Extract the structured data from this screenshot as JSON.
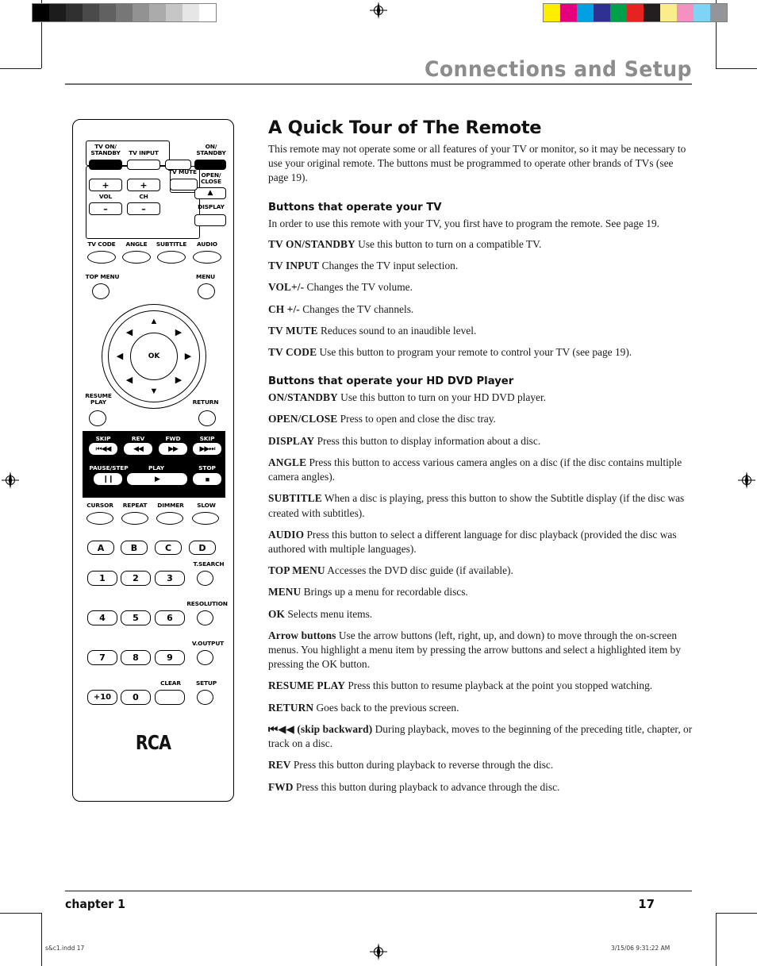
{
  "printer_marks": {
    "grayscale_steps": [
      "#000000",
      "#1c1c1c",
      "#303030",
      "#4a4a4a",
      "#606060",
      "#777777",
      "#929292",
      "#ababab",
      "#c6c6c6",
      "#e6e6e6",
      "#ffffff"
    ],
    "color_steps": [
      "#ffed00",
      "#e5007d",
      "#00a0e3",
      "#2e3192",
      "#00a04a",
      "#e52421",
      "#231f20",
      "#fbee8a",
      "#f391c0",
      "#7fd4f5",
      "#939598"
    ],
    "registration_icon": "registration-target-icon"
  },
  "header": {
    "title": "Connections and Setup"
  },
  "remote": {
    "brand": "RCA",
    "labels": {
      "tv_on_standby": "TV ON/\nSTANDBY",
      "tv_input": "TV INPUT",
      "on_standby": "ON/\nSTANDBY",
      "open_close": "OPEN/\nCLOSE",
      "display": "DISPLAY",
      "tv_mute": "TV MUTE",
      "vol": "VOL",
      "ch": "CH",
      "plus": "+",
      "minus": "–",
      "eject": "▲",
      "tv_code": "TV CODE",
      "angle": "ANGLE",
      "subtitle": "SUBTITLE",
      "audio": "AUDIO",
      "top_menu": "TOP MENU",
      "menu": "MENU",
      "ok": "OK",
      "resume_play": "RESUME\nPLAY",
      "return": "RETURN",
      "cursor": "CURSOR",
      "repeat": "REPEAT",
      "dimmer": "DIMMER",
      "slow": "SLOW",
      "t_search": "T.SEARCH",
      "resolution": "RESOLUTION",
      "v_output": "V.OUTPUT",
      "clear": "CLEAR",
      "setup": "SETUP"
    },
    "transport": {
      "skip_back_label": "SKIP",
      "rev_label": "REV",
      "fwd_label": "FWD",
      "skip_fwd_label": "SKIP",
      "pause_label": "PAUSE/STEP",
      "play_label": "PLAY",
      "stop_label": "STOP",
      "skip_back_glyph": "⏮◀◀",
      "rev_glyph": "◀◀",
      "fwd_glyph": "▶▶",
      "skip_fwd_glyph": "▶▶⏭",
      "pause_glyph": "❙❙",
      "play_glyph": "▶",
      "stop_glyph": "■"
    },
    "color_keys": [
      "A",
      "B",
      "C",
      "D"
    ],
    "numeric_keys": [
      "1",
      "2",
      "3",
      "4",
      "5",
      "6",
      "7",
      "8",
      "9",
      "+10",
      "0"
    ]
  },
  "content": {
    "title": "A Quick Tour of The Remote",
    "intro": "This remote may not operate some or all features of your TV or monitor, so it may be necessary to use your original remote. The buttons must be programmed to operate other brands of TVs (see page 19).",
    "tv_section": {
      "heading": "Buttons that operate your TV",
      "intro": "In order to use this remote with your TV, you first have to program the remote. See page 19.",
      "entries": [
        {
          "term": "TV ON/STANDBY",
          "desc": "Use this button to turn on a compatible TV."
        },
        {
          "term": "TV INPUT",
          "desc": "Changes the TV input selection."
        },
        {
          "term": "VOL+/-",
          "desc": "Changes the TV volume."
        },
        {
          "term": "CH +/-",
          "desc": "Changes the TV channels."
        },
        {
          "term": "TV MUTE",
          "desc": "Reduces sound to an inaudible level."
        },
        {
          "term": "TV CODE",
          "desc": "Use this button to program your remote to control your TV (see page 19)."
        }
      ]
    },
    "dvd_section": {
      "heading": "Buttons that operate your HD DVD Player",
      "entries": [
        {
          "term": "ON/STANDBY",
          "desc": "Use this button to turn on your HD DVD player."
        },
        {
          "term": "OPEN/CLOSE",
          "desc": "Press to open and close the disc tray."
        },
        {
          "term": "DISPLAY",
          "desc": "Press this button to display information about a disc."
        },
        {
          "term": "ANGLE",
          "desc": "Press this button to access various camera angles on a disc (if the disc contains multiple camera angles)."
        },
        {
          "term": "SUBTITLE",
          "desc": "When a disc is playing, press this button to show the Subtitle display (if the disc was created with subtitles)."
        },
        {
          "term": "AUDIO",
          "desc": "Press this button to select a different language for disc playback (provided the disc was authored with multiple languages)."
        },
        {
          "term": "TOP MENU",
          "desc": "Accesses the DVD disc guide (if available)."
        },
        {
          "term": "MENU",
          "desc": "Brings up a menu for recordable discs."
        },
        {
          "term": "OK",
          "desc": "Selects menu items."
        },
        {
          "term": "Arrow buttons",
          "desc": "Use the arrow buttons (left, right, up, and down) to move through the on-screen menus. You highlight a menu item by pressing the arrow buttons and select a highlighted item by pressing the OK button."
        },
        {
          "term": "RESUME PLAY",
          "desc": "Press this button to resume playback at the point you stopped watching."
        },
        {
          "term": "RETURN",
          "desc": "Goes back to the previous screen."
        },
        {
          "term": "⏮◀◀ (skip backward)",
          "desc": "During playback, moves to the beginning of the preceding title, chapter, or track on a disc."
        },
        {
          "term": "REV",
          "desc": "Press this button during playback to reverse through the disc."
        },
        {
          "term": "FWD",
          "desc": "Press this button during playback to advance through the disc."
        }
      ]
    }
  },
  "footer": {
    "chapter": "chapter 1",
    "page_number": "17",
    "slug_left": "s&c1.indd   17",
    "slug_right": "3/15/06   9:31:22 AM"
  }
}
